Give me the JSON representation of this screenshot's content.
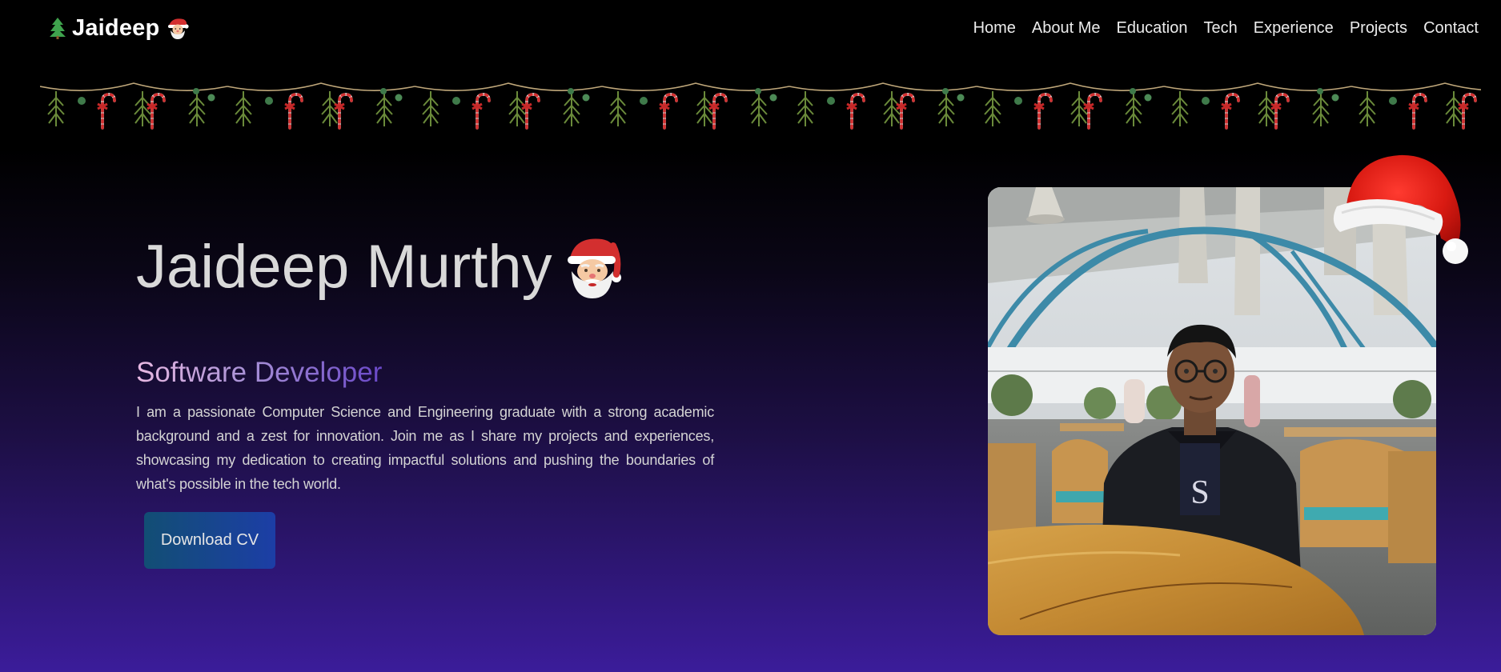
{
  "brand": {
    "name": "Jaideep",
    "icons": [
      "tree-icon",
      "santa-face-icon"
    ]
  },
  "nav": {
    "links": [
      {
        "label": "Home"
      },
      {
        "label": "About Me"
      },
      {
        "label": "Education"
      },
      {
        "label": "Tech"
      },
      {
        "label": "Experience"
      },
      {
        "label": "Projects"
      },
      {
        "label": "Contact"
      }
    ]
  },
  "decoration": {
    "garland": "christmas-garland",
    "hat": "santa-hat-icon"
  },
  "hero": {
    "name": "Jaideep Murthy",
    "name_icon": "santa-face-icon",
    "role": "Software Developer",
    "bio": "I am a passionate Computer Science and Engineering graduate with a strong academic background and a zest for innovation. Join me as I share my projects and experiences, showcasing my dedication to creating impactful solutions and pushing the boundaries of what's possible in the tech world.",
    "cta_label": "Download CV"
  },
  "photo": {
    "subject": "profile-photo"
  },
  "colors": {
    "background_top": "#000000",
    "background_bottom": "#3b1c9a",
    "role_gradient_start": "#e8b9e2",
    "role_gradient_end": "#6a48c8",
    "cta_gradient_start": "#124e74",
    "cta_gradient_end": "#1c3ea6"
  }
}
